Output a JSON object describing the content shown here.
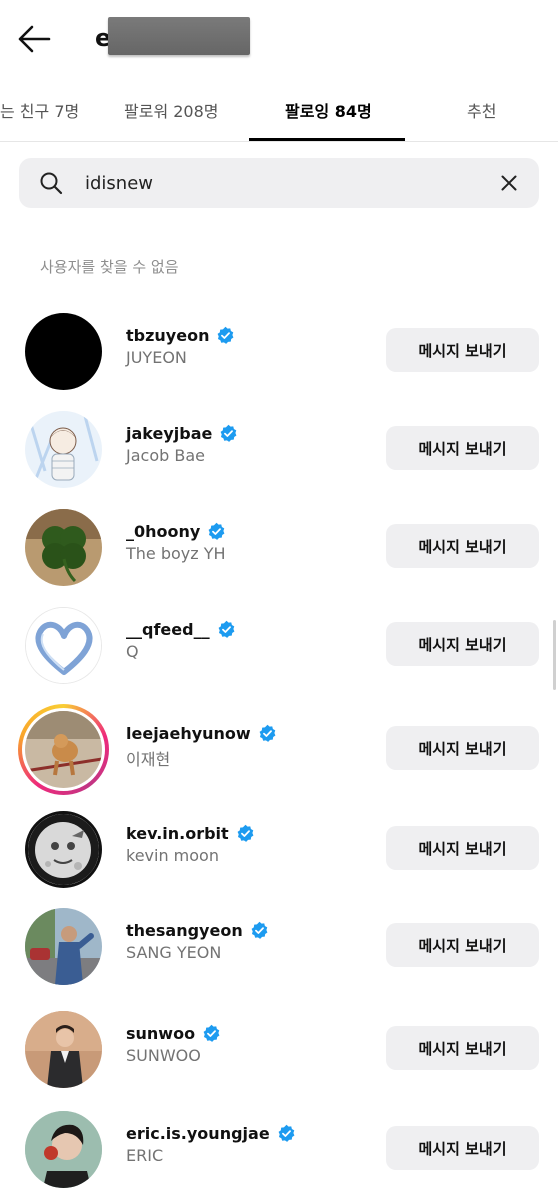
{
  "header": {
    "back_icon": "arrow-left-icon",
    "title_visible": "e"
  },
  "tabs": [
    {
      "label": "는 친구 7명"
    },
    {
      "label": "팔로워 208명"
    },
    {
      "label": "팔로잉 84명",
      "active": true
    },
    {
      "label": "추천"
    }
  ],
  "search": {
    "icon": "search-icon",
    "value": "idisnew",
    "clear_icon": "close-icon"
  },
  "not_found_text": "사용자를 찾을 수 없음",
  "button_label": "메시지 보내기",
  "colors": {
    "verified": "#1d9bf0",
    "button_bg": "#efeff1",
    "secondary_text": "#737373"
  },
  "accounts": [
    {
      "username": "tbzuyeon",
      "name": "JUYEON",
      "verified": true
    },
    {
      "username": "jakeyjbae",
      "name": "Jacob Bae",
      "verified": true
    },
    {
      "username": "_0hoony",
      "name": "The boyz YH",
      "verified": true
    },
    {
      "username": "__qfeed__",
      "name": "Q",
      "verified": true
    },
    {
      "username": "leejaehyunow",
      "name": "이재현",
      "verified": true,
      "has_story": true
    },
    {
      "username": "kev.in.orbit",
      "name": "kevin moon",
      "verified": true
    },
    {
      "username": "thesangyeon",
      "name": "SANG YEON",
      "verified": true
    },
    {
      "username": "sunwoo",
      "name": "SUNWOO",
      "verified": true
    },
    {
      "username": "eric.is.youngjae",
      "name": "ERIC",
      "verified": true
    }
  ]
}
